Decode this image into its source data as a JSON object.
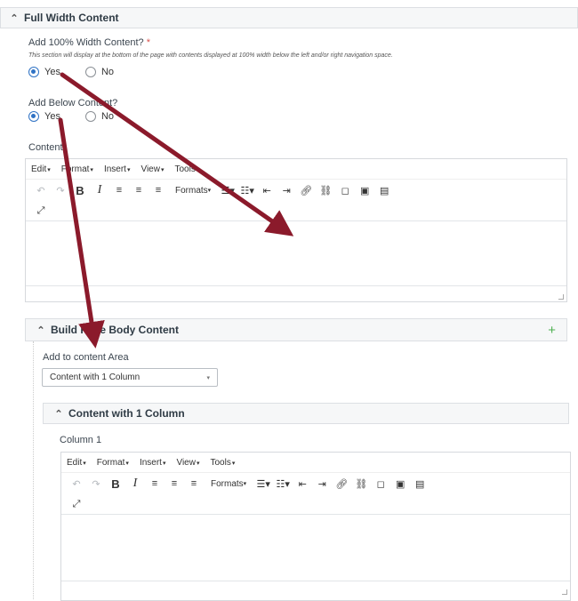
{
  "full_width": {
    "title": "Full Width Content",
    "question": "Add 100% Width Content?",
    "required_mark": "*",
    "help": "This section will display at the bottom of the page with contents displayed at 100% width below the left and/or right navigation space.",
    "yes": "Yes",
    "no": "No",
    "selected": "Yes"
  },
  "below": {
    "question": "Add Below Content?",
    "yes": "Yes",
    "no": "No",
    "selected": "Yes"
  },
  "content_label": "Content",
  "editor_menu": [
    "Edit",
    "Format",
    "Insert",
    "View",
    "Tools"
  ],
  "editor_formats_label": "Formats",
  "build_body": {
    "title": "Build Page Body Content",
    "add_label": "Add to content Area",
    "select_value": "Content with 1 Column"
  },
  "content_block": {
    "title": "Content with 1 Column",
    "column_label": "Column 1"
  },
  "icons": {
    "chevron": "chevron-up-icon",
    "plus": "plus-icon",
    "annotation": "red-arrow-annotation"
  },
  "colors": {
    "accent": "#2f72c4",
    "arrow": "#8b1a2b",
    "plus": "#4caf50"
  }
}
